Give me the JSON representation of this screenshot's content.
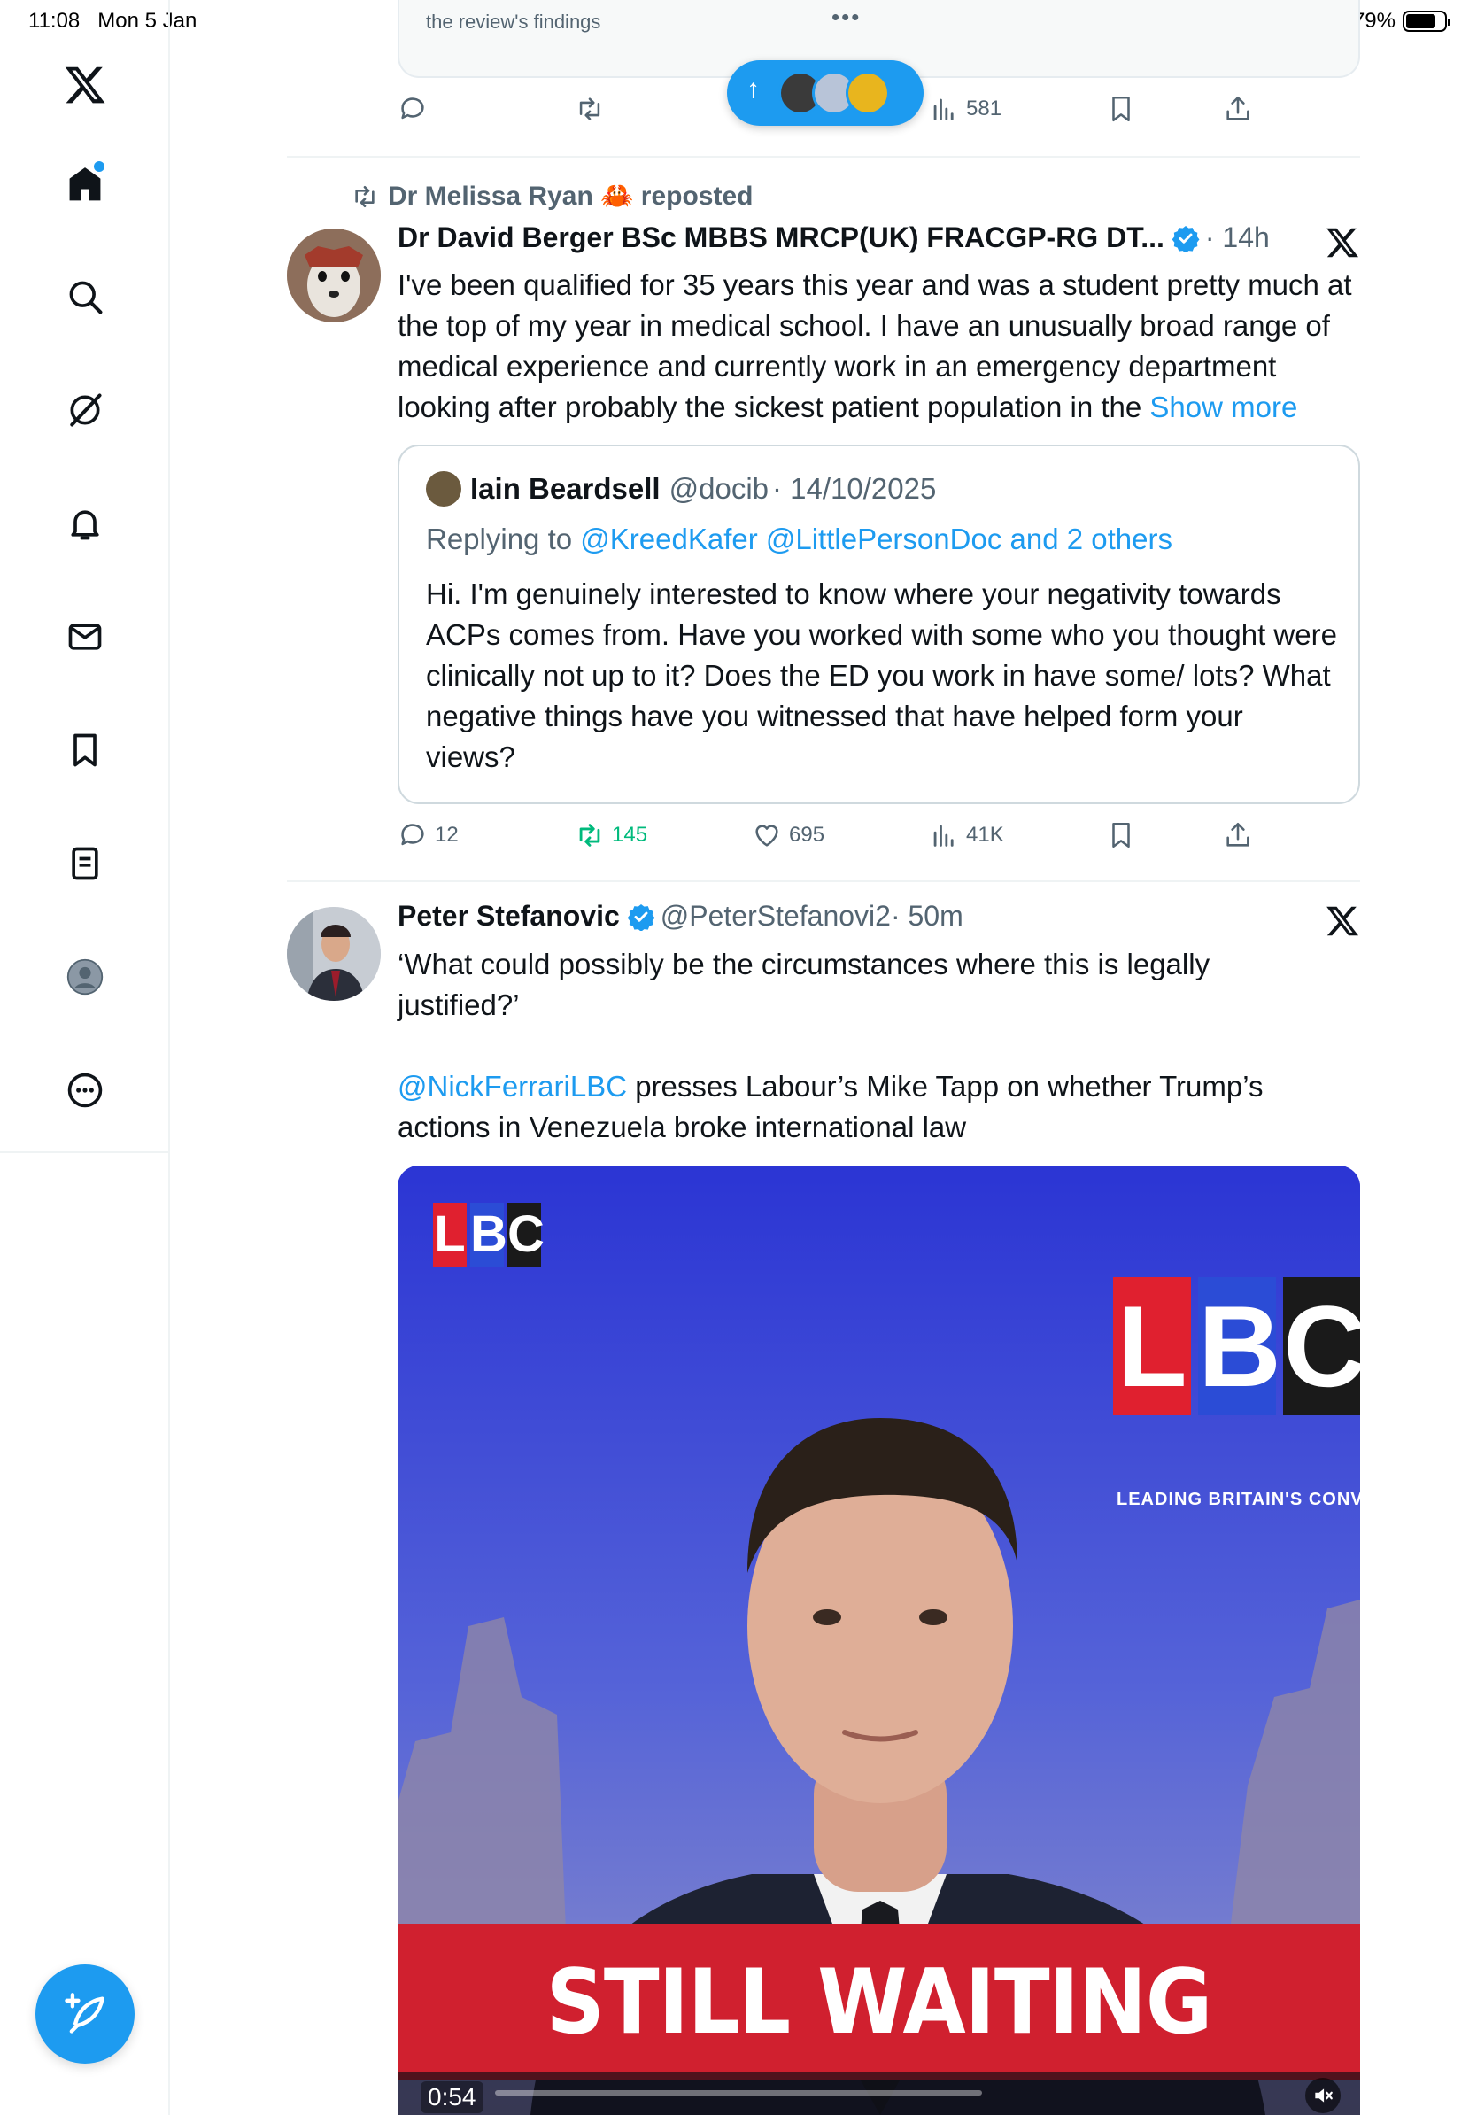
{
  "status_bar": {
    "time": "11:08",
    "date": "Mon 5 Jan",
    "battery": "79%"
  },
  "nav": {
    "items": [
      "x-logo",
      "home",
      "explore",
      "grok",
      "notifications",
      "messages",
      "bookmarks",
      "lists",
      "profile",
      "more"
    ],
    "compose_label": "Compose post"
  },
  "prev_tweet": {
    "card_text": "the review's findings",
    "card_more": "•••",
    "stats": {
      "views": "581"
    }
  },
  "new_posts_pill": {
    "arrow": "↑"
  },
  "tweet1": {
    "reposted_by": "Dr Melissa Ryan 🦀 reposted",
    "name": "Dr David Berger BSc MBBS MRCP(UK) FRACGP-RG DT...",
    "time": "· 14h",
    "body": "I've been qualified for 35 years this year and was a student pretty much at the top of my year in medical school. I have an unusually broad range of medical experience and currently work in an emergency department looking after probably the sickest patient population in the ",
    "show_more": "Show more",
    "quote": {
      "name": "Iain Beardsell",
      "handle": "@docib",
      "date": "· 14/10/2025",
      "replying_prefix": "Replying to ",
      "replying_to": "@KreedKafer @LittlePersonDoc and 2 others",
      "body": "Hi. I'm genuinely interested to know where your negativity towards ACPs comes from. Have you worked with some who you thought were clinically not up to it? Does the ED you work in have some/ lots? What negative things have you witnessed that have helped form your views?"
    },
    "stats": {
      "replies": "12",
      "reposts": "145",
      "likes": "695",
      "views": "41K"
    }
  },
  "tweet2": {
    "name": "Peter Stefanovic",
    "handle": "@PeterStefanovi2",
    "time": "· 50m",
    "body_line1": "‘What could possibly be the circumstances where this is legally justified?’",
    "mention": "@NickFerrariLBC",
    "body_line2": " presses Labour’s Mike Tapp on whether Trump’s actions in Venezuela broke international law",
    "media": {
      "logo_letters": [
        "L",
        "B",
        "C"
      ],
      "tagline": "LEADING BRITAIN'S CONVERSATIO",
      "banner": "STILL WAITING",
      "duration": "0:54"
    }
  },
  "colors": {
    "accent": "#1d9bf0",
    "repost_green": "#00ba7c",
    "muted": "#536471",
    "banner_red": "#d0202f"
  }
}
